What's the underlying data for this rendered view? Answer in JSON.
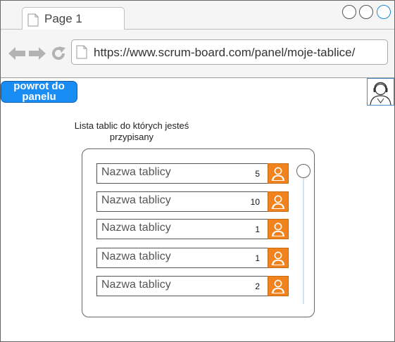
{
  "browser": {
    "tab_label": "Page 1",
    "url": "https://www.scrum-board.com/panel/moje-tablice/",
    "window_controls": [
      "circle-icon",
      "circle-icon",
      "circle-icon"
    ]
  },
  "header": {
    "back_button_label": "powrot do panelu",
    "avatar_icon": "user-avatar-icon"
  },
  "list": {
    "heading": "Lista tablic do których jesteś przypisany",
    "rows": [
      {
        "name": "Nazwa tablicy",
        "count": "5"
      },
      {
        "name": "Nazwa tablicy",
        "count": "10"
      },
      {
        "name": "Nazwa tablicy",
        "count": "1"
      },
      {
        "name": "Nazwa tablicy",
        "count": "1"
      },
      {
        "name": "Nazwa tablicy",
        "count": "2"
      }
    ]
  },
  "colors": {
    "accent_blue": "#1a8df5",
    "user_icon_orange": "#f0831e"
  }
}
